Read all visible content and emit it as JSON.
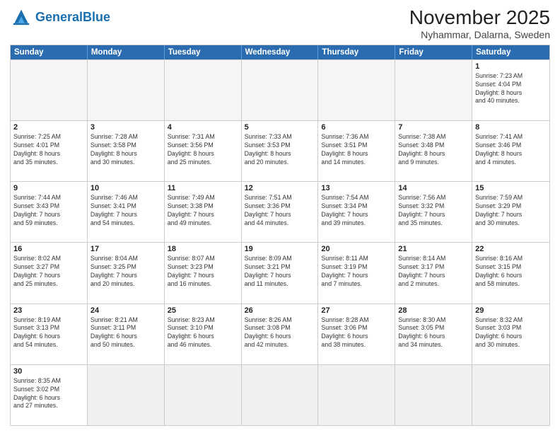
{
  "header": {
    "logo_general": "General",
    "logo_blue": "Blue",
    "month_year": "November 2025",
    "location": "Nyhammar, Dalarna, Sweden"
  },
  "weekdays": [
    "Sunday",
    "Monday",
    "Tuesday",
    "Wednesday",
    "Thursday",
    "Friday",
    "Saturday"
  ],
  "rows": [
    [
      {
        "day": "",
        "info": ""
      },
      {
        "day": "",
        "info": ""
      },
      {
        "day": "",
        "info": ""
      },
      {
        "day": "",
        "info": ""
      },
      {
        "day": "",
        "info": ""
      },
      {
        "day": "",
        "info": ""
      },
      {
        "day": "1",
        "info": "Sunrise: 7:23 AM\nSunset: 4:04 PM\nDaylight: 8 hours\nand 40 minutes."
      }
    ],
    [
      {
        "day": "2",
        "info": "Sunrise: 7:25 AM\nSunset: 4:01 PM\nDaylight: 8 hours\nand 35 minutes."
      },
      {
        "day": "3",
        "info": "Sunrise: 7:28 AM\nSunset: 3:58 PM\nDaylight: 8 hours\nand 30 minutes."
      },
      {
        "day": "4",
        "info": "Sunrise: 7:31 AM\nSunset: 3:56 PM\nDaylight: 8 hours\nand 25 minutes."
      },
      {
        "day": "5",
        "info": "Sunrise: 7:33 AM\nSunset: 3:53 PM\nDaylight: 8 hours\nand 20 minutes."
      },
      {
        "day": "6",
        "info": "Sunrise: 7:36 AM\nSunset: 3:51 PM\nDaylight: 8 hours\nand 14 minutes."
      },
      {
        "day": "7",
        "info": "Sunrise: 7:38 AM\nSunset: 3:48 PM\nDaylight: 8 hours\nand 9 minutes."
      },
      {
        "day": "8",
        "info": "Sunrise: 7:41 AM\nSunset: 3:46 PM\nDaylight: 8 hours\nand 4 minutes."
      }
    ],
    [
      {
        "day": "9",
        "info": "Sunrise: 7:44 AM\nSunset: 3:43 PM\nDaylight: 7 hours\nand 59 minutes."
      },
      {
        "day": "10",
        "info": "Sunrise: 7:46 AM\nSunset: 3:41 PM\nDaylight: 7 hours\nand 54 minutes."
      },
      {
        "day": "11",
        "info": "Sunrise: 7:49 AM\nSunset: 3:38 PM\nDaylight: 7 hours\nand 49 minutes."
      },
      {
        "day": "12",
        "info": "Sunrise: 7:51 AM\nSunset: 3:36 PM\nDaylight: 7 hours\nand 44 minutes."
      },
      {
        "day": "13",
        "info": "Sunrise: 7:54 AM\nSunset: 3:34 PM\nDaylight: 7 hours\nand 39 minutes."
      },
      {
        "day": "14",
        "info": "Sunrise: 7:56 AM\nSunset: 3:32 PM\nDaylight: 7 hours\nand 35 minutes."
      },
      {
        "day": "15",
        "info": "Sunrise: 7:59 AM\nSunset: 3:29 PM\nDaylight: 7 hours\nand 30 minutes."
      }
    ],
    [
      {
        "day": "16",
        "info": "Sunrise: 8:02 AM\nSunset: 3:27 PM\nDaylight: 7 hours\nand 25 minutes."
      },
      {
        "day": "17",
        "info": "Sunrise: 8:04 AM\nSunset: 3:25 PM\nDaylight: 7 hours\nand 20 minutes."
      },
      {
        "day": "18",
        "info": "Sunrise: 8:07 AM\nSunset: 3:23 PM\nDaylight: 7 hours\nand 16 minutes."
      },
      {
        "day": "19",
        "info": "Sunrise: 8:09 AM\nSunset: 3:21 PM\nDaylight: 7 hours\nand 11 minutes."
      },
      {
        "day": "20",
        "info": "Sunrise: 8:11 AM\nSunset: 3:19 PM\nDaylight: 7 hours\nand 7 minutes."
      },
      {
        "day": "21",
        "info": "Sunrise: 8:14 AM\nSunset: 3:17 PM\nDaylight: 7 hours\nand 2 minutes."
      },
      {
        "day": "22",
        "info": "Sunrise: 8:16 AM\nSunset: 3:15 PM\nDaylight: 6 hours\nand 58 minutes."
      }
    ],
    [
      {
        "day": "23",
        "info": "Sunrise: 8:19 AM\nSunset: 3:13 PM\nDaylight: 6 hours\nand 54 minutes."
      },
      {
        "day": "24",
        "info": "Sunrise: 8:21 AM\nSunset: 3:11 PM\nDaylight: 6 hours\nand 50 minutes."
      },
      {
        "day": "25",
        "info": "Sunrise: 8:23 AM\nSunset: 3:10 PM\nDaylight: 6 hours\nand 46 minutes."
      },
      {
        "day": "26",
        "info": "Sunrise: 8:26 AM\nSunset: 3:08 PM\nDaylight: 6 hours\nand 42 minutes."
      },
      {
        "day": "27",
        "info": "Sunrise: 8:28 AM\nSunset: 3:06 PM\nDaylight: 6 hours\nand 38 minutes."
      },
      {
        "day": "28",
        "info": "Sunrise: 8:30 AM\nSunset: 3:05 PM\nDaylight: 6 hours\nand 34 minutes."
      },
      {
        "day": "29",
        "info": "Sunrise: 8:32 AM\nSunset: 3:03 PM\nDaylight: 6 hours\nand 30 minutes."
      }
    ],
    [
      {
        "day": "30",
        "info": "Sunrise: 8:35 AM\nSunset: 3:02 PM\nDaylight: 6 hours\nand 27 minutes."
      },
      {
        "day": "",
        "info": ""
      },
      {
        "day": "",
        "info": ""
      },
      {
        "day": "",
        "info": ""
      },
      {
        "day": "",
        "info": ""
      },
      {
        "day": "",
        "info": ""
      },
      {
        "day": "",
        "info": ""
      }
    ]
  ]
}
